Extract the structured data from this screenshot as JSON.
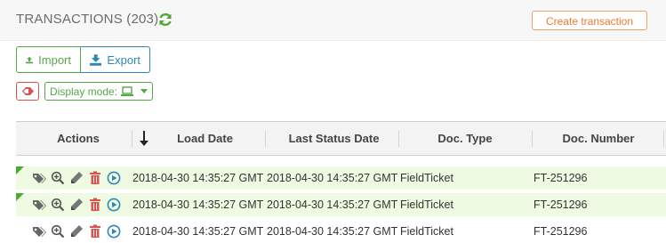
{
  "header": {
    "title": "TRANSACTIONS (203)",
    "refresh_icon": "refresh-icon",
    "create_button": "Create transaction"
  },
  "toolbar": {
    "import_label": "Import",
    "export_label": "Export",
    "display_mode_label": "Display mode:",
    "display_mode_icon": "laptop-icon"
  },
  "table": {
    "columns": [
      "Actions",
      "Load Date",
      "Last Status Date",
      "Doc. Type",
      "Doc. Number"
    ],
    "sort_icon": "arrow-down-icon",
    "rows": [
      {
        "load_date": "2018-04-30 14:35:27 GMT",
        "status_date": "2018-04-30 14:35:27 GMT",
        "doc_type": "FieldTicket",
        "doc_number": "FT-251296"
      },
      {
        "load_date": "2018-04-30 14:35:27 GMT",
        "status_date": "2018-04-30 14:35:27 GMT",
        "doc_type": "FieldTicket",
        "doc_number": "FT-251296"
      },
      {
        "load_date": "2018-04-30 14:35:27 GMT",
        "status_date": "2018-04-30 14:35:27 GMT",
        "doc_type": "FieldTicket",
        "doc_number": "FT-251296"
      }
    ]
  },
  "colors": {
    "green": "#58a64a",
    "blue": "#2d87b9",
    "orange": "#ec7a34",
    "red": "#d9534f",
    "row_highlight": "#effae3"
  }
}
